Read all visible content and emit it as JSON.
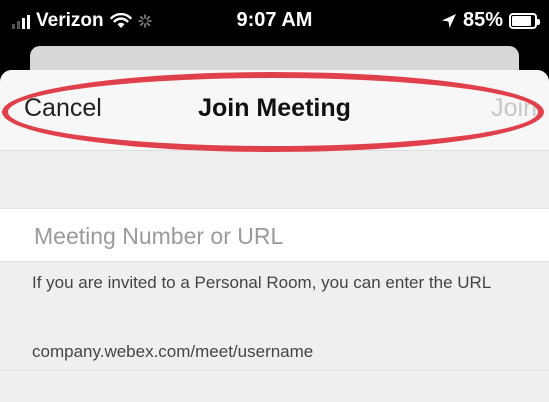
{
  "status_bar": {
    "carrier": "Verizon",
    "time": "9:07 AM",
    "battery_percent": "85%",
    "battery_level": 0.85,
    "icons": [
      "signal-icon",
      "wifi-icon",
      "activity-spinner-icon",
      "location-arrow-icon",
      "battery-icon"
    ]
  },
  "nav": {
    "cancel_label": "Cancel",
    "title": "Join Meeting",
    "join_label": "Join"
  },
  "form": {
    "meeting_input": {
      "value": "",
      "placeholder": "Meeting Number or URL"
    },
    "help_text": "If you are invited to a Personal Room, you can enter the URL",
    "example_url": "company.webex.com/meet/username"
  },
  "colors": {
    "highlight": "#e0404b",
    "status_bar": "#000000",
    "sheet_background": "#efefef",
    "join_disabled": "#c8c8c8"
  }
}
